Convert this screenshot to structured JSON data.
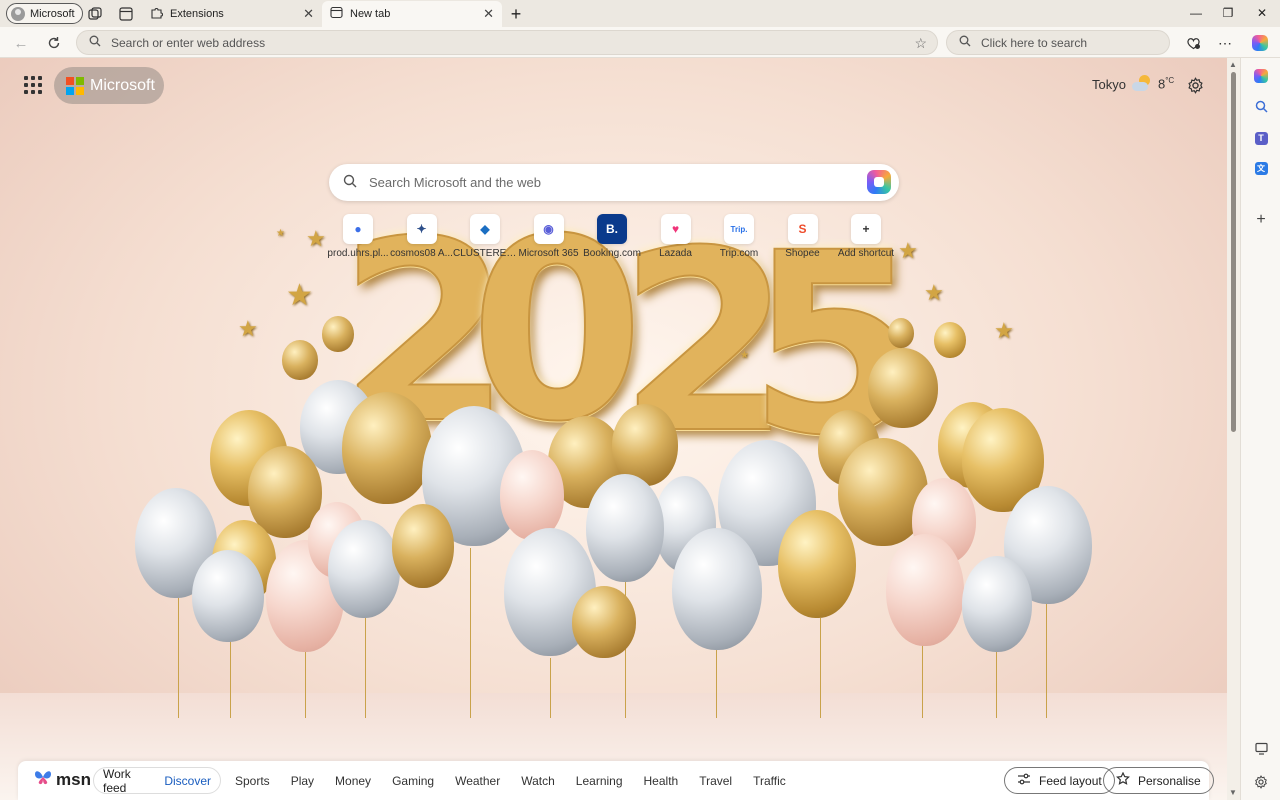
{
  "titlebar": {
    "profile_label": "Microsoft",
    "tabs": [
      {
        "label": "Extensions"
      },
      {
        "label": "New tab"
      }
    ],
    "new_tab_glyph": "+",
    "window_controls": [
      "—",
      "❐",
      "✕"
    ]
  },
  "navbar": {
    "address_placeholder": "Search or enter web address",
    "search_placeholder": "Click here to search"
  },
  "page": {
    "logo_text": "Microsoft",
    "weather": {
      "city": "Tokyo",
      "temp": "8",
      "unit": "°C"
    },
    "search_placeholder": "Search Microsoft and the web",
    "shortcuts": [
      {
        "label": "prod.uhrs.pl...",
        "glyph": "●",
        "color": "#3b6fe8"
      },
      {
        "label": "cosmos08 A...",
        "glyph": "✦",
        "color": "#2d4f8a"
      },
      {
        "label": "CLUSTERED ...",
        "glyph": "◆",
        "color": "#1b6ec2"
      },
      {
        "label": "Microsoft 365",
        "glyph": "◉",
        "color": "#5a5fd8"
      },
      {
        "label": "Booking.com",
        "glyph": "B.",
        "color": "#ffffff",
        "bg": "#0a3a8c"
      },
      {
        "label": "Lazada",
        "glyph": "♥",
        "color": "#f0357a"
      },
      {
        "label": "Trip.com",
        "glyph": "Trip.",
        "color": "#2870e8"
      },
      {
        "label": "Shopee",
        "glyph": "S",
        "color": "#ee4d2d"
      },
      {
        "label": "Add shortcut",
        "glyph": "+",
        "color": "#333333"
      }
    ],
    "year_digits": [
      "2",
      "0",
      "2",
      "5"
    ]
  },
  "msn": {
    "logo": "msn",
    "feed_toggle": {
      "work": "Work feed",
      "discover": "Discover"
    },
    "nav": [
      "Sports",
      "Play",
      "Money",
      "Gaming",
      "Weather",
      "Watch",
      "Learning",
      "Health",
      "Travel",
      "Traffic"
    ],
    "feed_layout": "Feed layout",
    "personalise": "Personalise"
  },
  "colors": {
    "accent": "#1a5dbf",
    "ms_red": "#f25022",
    "ms_green": "#7fba00",
    "ms_blue": "#00a4ef",
    "ms_yellow": "#ffb900"
  }
}
